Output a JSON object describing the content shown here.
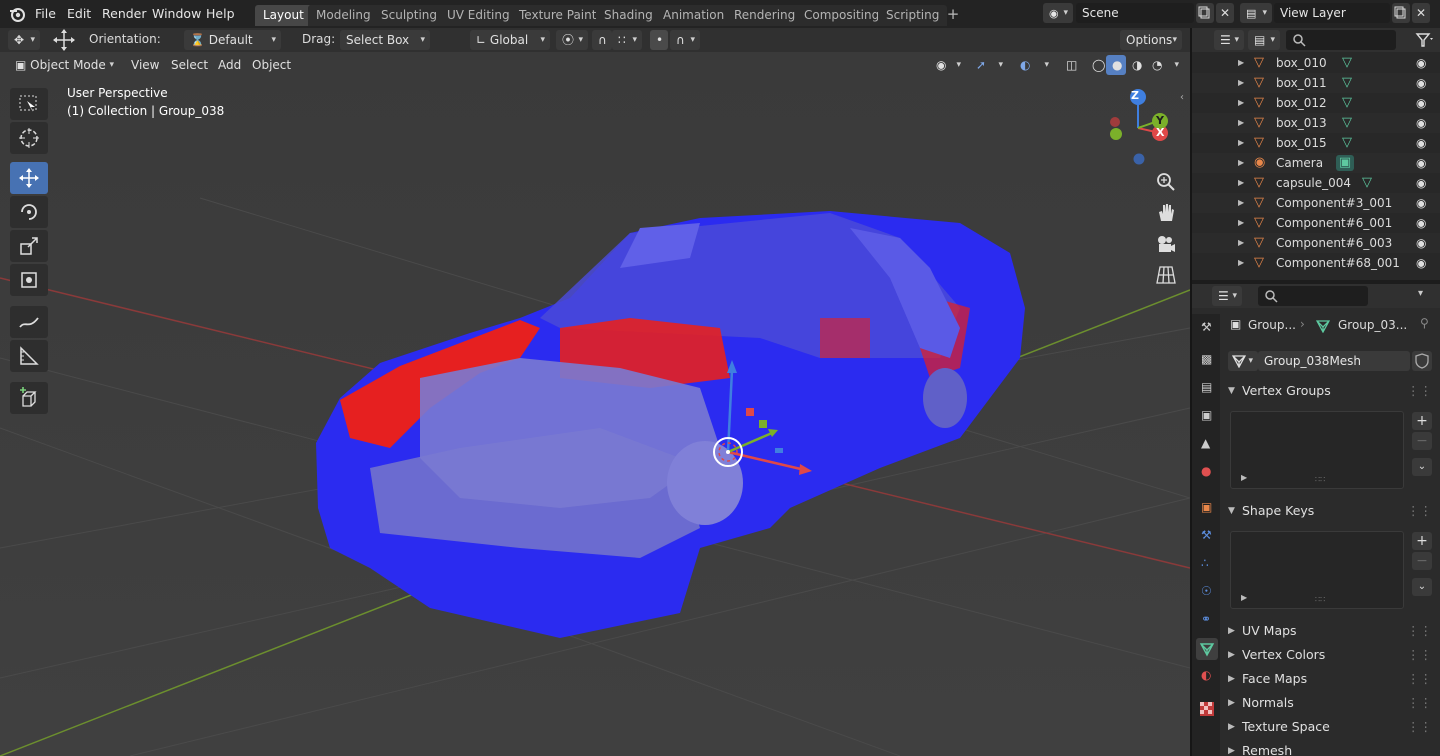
{
  "topbar": {
    "menus": [
      "File",
      "Edit",
      "Render",
      "Window",
      "Help"
    ],
    "workspaces": [
      "Layout",
      "Modeling",
      "Sculpting",
      "UV Editing",
      "Texture Paint",
      "Shading",
      "Animation",
      "Rendering",
      "Compositing",
      "Scripting"
    ],
    "active_workspace": "Layout",
    "scene": "Scene",
    "view_layer": "View Layer"
  },
  "tool_header": {
    "orientation_label": "Orientation:",
    "orientation_value": "Default",
    "drag_label": "Drag:",
    "drag_value": "Select Box",
    "transform_space": "Global",
    "options": "Options"
  },
  "viewport_header": {
    "mode": "Object Mode",
    "menus": [
      "View",
      "Select",
      "Add",
      "Object"
    ]
  },
  "viewport": {
    "perspective": "User Perspective",
    "collection_info": "(1) Collection | Group_038",
    "gizmo": {
      "x": "X",
      "y": "Y",
      "z": "Z"
    }
  },
  "outliner": {
    "items": [
      {
        "name": "box_010",
        "type": "mesh"
      },
      {
        "name": "box_011",
        "type": "mesh"
      },
      {
        "name": "box_012",
        "type": "mesh"
      },
      {
        "name": "box_013",
        "type": "mesh"
      },
      {
        "name": "box_015",
        "type": "mesh"
      },
      {
        "name": "Camera",
        "type": "camera"
      },
      {
        "name": "capsule_004",
        "type": "mesh"
      },
      {
        "name": "Component#3_001",
        "type": "mesh"
      },
      {
        "name": "Component#6_001",
        "type": "mesh"
      },
      {
        "name": "Component#6_003",
        "type": "mesh"
      },
      {
        "name": "Component#68_001",
        "type": "mesh"
      }
    ]
  },
  "properties": {
    "breadcrumb_object": "Group...",
    "breadcrumb_data": "Group_03...",
    "mesh_name": "Group_038Mesh",
    "panels_expanded": [
      "Vertex Groups",
      "Shape Keys"
    ],
    "panels_collapsed": [
      "UV Maps",
      "Vertex Colors",
      "Face Maps",
      "Normals",
      "Texture Space",
      "Remesh"
    ]
  },
  "colors": {
    "accent": "#4772b3",
    "mesh_blue": "#2b2bf0",
    "mesh_red": "#e62020",
    "axis_x": "#e04848",
    "axis_y": "#7bb02a",
    "axis_z": "#3f7fe0",
    "object_orange": "#e8874a",
    "mesh_green": "#5ec9a0"
  }
}
